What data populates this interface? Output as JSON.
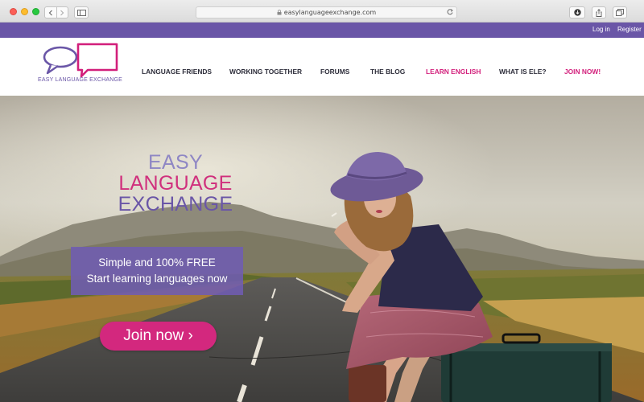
{
  "browser": {
    "url": "easylanguageexchange.com"
  },
  "topbar": {
    "login_label": "Log in",
    "register_label": "Register"
  },
  "logo": {
    "text": "EASY LANGUAGE EXCHANGE"
  },
  "nav": {
    "items": [
      {
        "label": "LANGUAGE FRIENDS",
        "highlight": false
      },
      {
        "label": "WORKING TOGETHER",
        "highlight": false
      },
      {
        "label": "FORUMS",
        "highlight": false
      },
      {
        "label": "THE BLOG",
        "highlight": false
      },
      {
        "label": "LEARN ENGLISH",
        "highlight": true
      },
      {
        "label": "WHAT IS ELE?",
        "highlight": false
      },
      {
        "label": "JOIN NOW!",
        "highlight": true
      }
    ]
  },
  "hero": {
    "title_line1": "EASY",
    "title_line2": "LANGUAGE",
    "title_line3": "EXCHANGE",
    "promo_line1": "Simple and 100% FREE",
    "promo_line2": "Start learning languages now",
    "cta_label": "Join now ›"
  },
  "colors": {
    "brand_purple": "#6a56a7",
    "brand_pink": "#d21f7b",
    "light_purple": "#8f87c4"
  },
  "icons": [
    "back-icon",
    "forward-icon",
    "sidebar-icon",
    "lock-icon",
    "reload-icon",
    "download-icon",
    "share-icon",
    "tabs-icon",
    "speech-bubbles-logo-icon"
  ]
}
